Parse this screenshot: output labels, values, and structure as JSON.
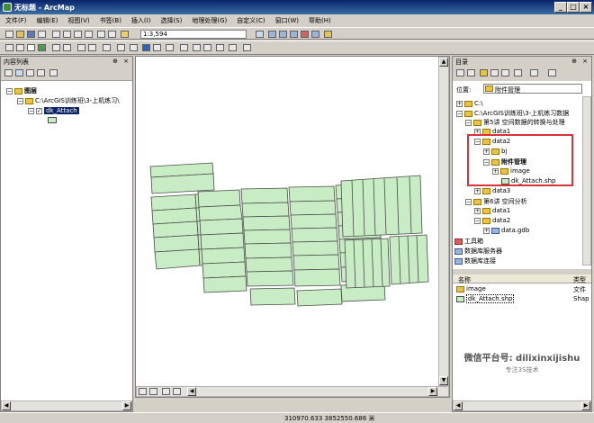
{
  "window": {
    "title": "无标题 - ArcMap"
  },
  "menu": [
    "文件(F)",
    "编辑(E)",
    "视图(V)",
    "书签(B)",
    "插入(I)",
    "选择(S)",
    "地理处理(G)",
    "自定义(C)",
    "窗口(W)",
    "帮助(H)"
  ],
  "toolbar": {
    "scale_value": "1:3,594"
  },
  "toc": {
    "title": "内容列表",
    "root": "图层",
    "path": "C:\\ArcGIS训练班\\3-上机练习\\",
    "layer": "dk_Attach"
  },
  "catalog": {
    "title": "目录",
    "location_label": "位置:",
    "location_value": "附件管理",
    "tree": [
      "C:\\",
      "C:\\ArcGIS训练班\\3-上机练习数据",
      "第5讲 空间数据的转换与处理",
      "data1",
      "data2",
      "bj",
      "附件管理",
      "image",
      "dk_Attach.shp",
      "data3",
      "第6讲 空间分析",
      "data1",
      "data2",
      "data.gdb",
      "工具箱",
      "数据库服务器",
      "数据库连接"
    ],
    "list_headers": [
      "名称",
      "类型"
    ],
    "list_rows": [
      {
        "name": "image",
        "type": "文件"
      },
      {
        "name": "dk_Attach.shp",
        "type": "Shap"
      }
    ]
  },
  "watermark": {
    "line1": "微信平台号: dilixinxijishu",
    "line2": "专注3S技术"
  },
  "status": {
    "coords": "310970.633  3852550.686 米"
  },
  "colors": {
    "polygon_fill": "#c8ecc4",
    "highlight_box": "#d9323a",
    "title_bar": "#0a246a"
  }
}
